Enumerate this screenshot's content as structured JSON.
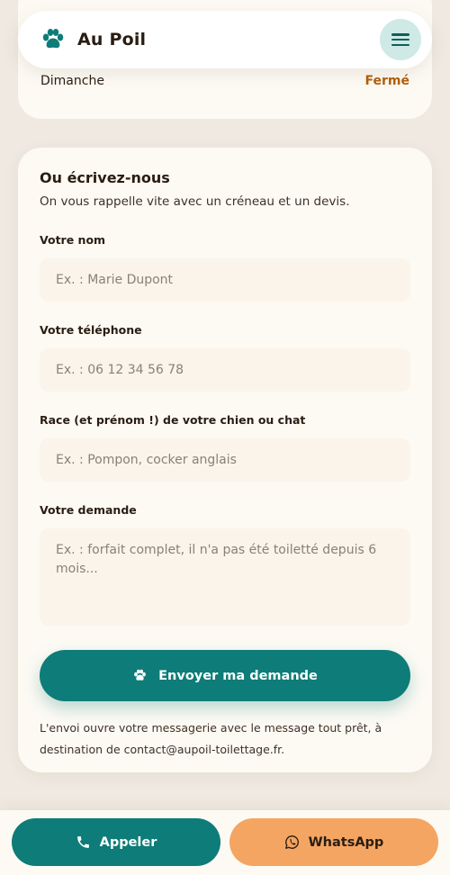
{
  "header": {
    "brand": "Au Poil",
    "logo_icon": "paw-icon",
    "menu_icon": "hamburger-icon"
  },
  "hours": {
    "day": "Dimanche",
    "status": "Fermé"
  },
  "form": {
    "title": "Ou écrivez-nous",
    "subtitle": "On vous rappelle vite avec un créneau et un devis.",
    "fields": [
      {
        "label": "Votre nom",
        "placeholder": "Ex. : Marie Dupont",
        "value": ""
      },
      {
        "label": "Votre téléphone",
        "placeholder": "Ex. : 06 12 34 56 78",
        "value": ""
      },
      {
        "label": "Race (et prénom !) de votre chien ou chat",
        "placeholder": "Ex. : Pompon, cocker anglais",
        "value": ""
      },
      {
        "label": "Votre demande",
        "placeholder": "Ex. : forfait complet, il n'a pas été toiletté depuis 6 mois...",
        "value": ""
      }
    ],
    "submit_label": "Envoyer ma demande",
    "note": "L'envoi ouvre votre messagerie avec le message tout prêt, à destination de contact@aupoil-toilettage.fr."
  },
  "bottom_bar": {
    "call_label": "Appeler",
    "whatsapp_label": "WhatsApp"
  },
  "colors": {
    "brand_teal": "#0e7c78",
    "accent_orange": "#f4a562",
    "closed_text": "#b35f0a",
    "card_bg": "#fdfaf4",
    "page_bg": "#efe9e1"
  }
}
